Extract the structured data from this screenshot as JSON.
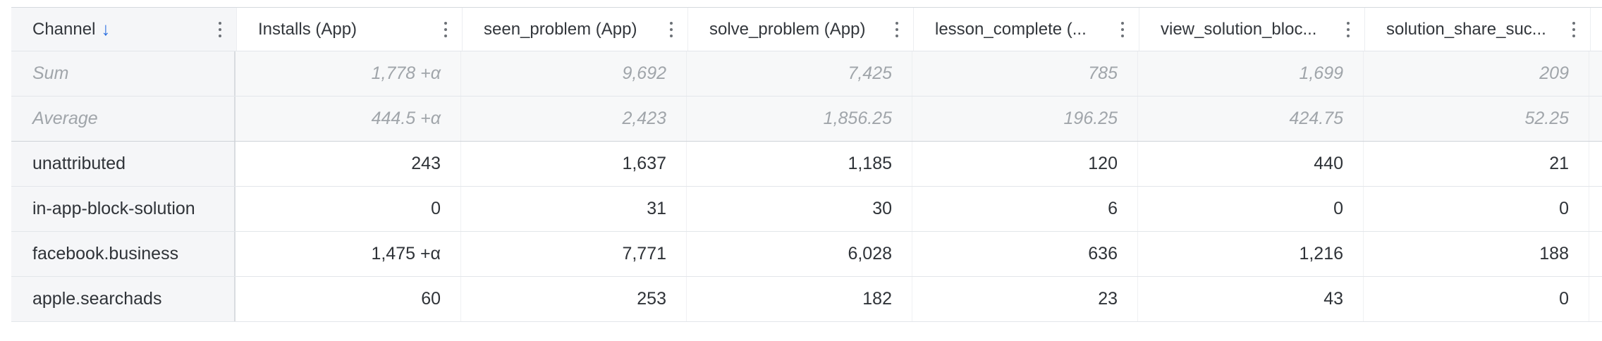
{
  "table": {
    "columns": [
      "Channel",
      "Installs (App)",
      "seen_problem (App)",
      "solve_problem (App)",
      "lesson_complete (...",
      "view_solution_bloc...",
      "solution_share_suc..."
    ],
    "sort_indicator": "↓",
    "summary_rows": [
      {
        "label": "Sum",
        "values": [
          "1,778 +α",
          "9,692",
          "7,425",
          "785",
          "1,699",
          "209"
        ]
      },
      {
        "label": "Average",
        "values": [
          "444.5 +α",
          "2,423",
          "1,856.25",
          "196.25",
          "424.75",
          "52.25"
        ]
      }
    ],
    "rows": [
      {
        "channel": "unattributed",
        "values": [
          "243",
          "1,637",
          "1,185",
          "120",
          "440",
          "21"
        ]
      },
      {
        "channel": "in-app-block-solution",
        "values": [
          "0",
          "31",
          "30",
          "6",
          "0",
          "0"
        ]
      },
      {
        "channel": "facebook.business",
        "values": [
          "1,475 +α",
          "7,771",
          "6,028",
          "636",
          "1,216",
          "188"
        ]
      },
      {
        "channel": "apple.searchads",
        "values": [
          "60",
          "253",
          "182",
          "23",
          "43",
          "0"
        ]
      }
    ]
  },
  "colors": {
    "accent": "#2b6fe0",
    "header_bg": "#f5f6f8",
    "summary_text": "#a0a5aa"
  },
  "icons": {
    "column_menu": "vertical-dots-icon",
    "sort": "arrow-down-icon"
  }
}
